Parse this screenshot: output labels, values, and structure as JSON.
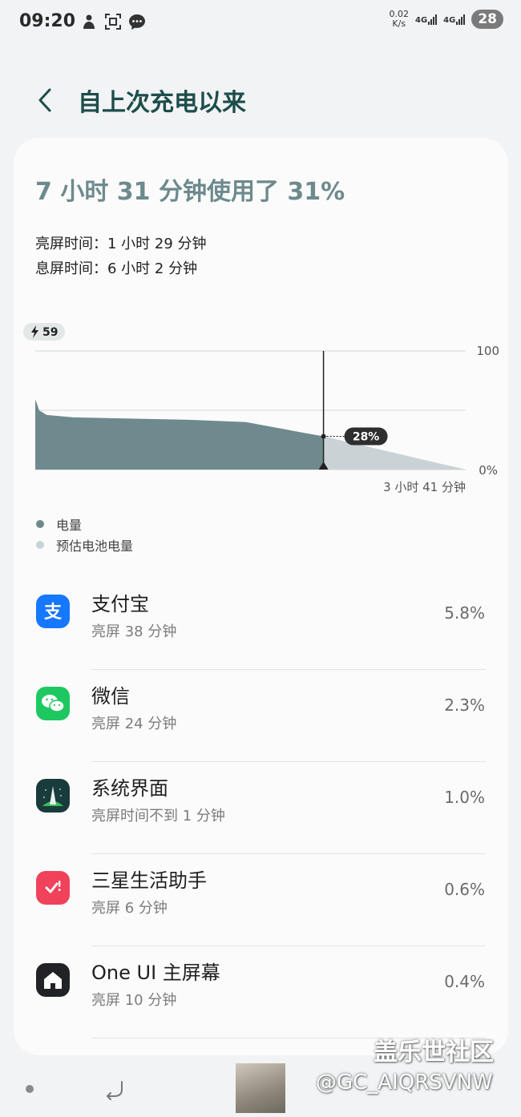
{
  "status_bar": {
    "time": "09:20",
    "speed_value": "0.02",
    "speed_unit": "K/s",
    "net1": "4G",
    "net2": "4G",
    "battery": "28",
    "icons": [
      "gesture-icon",
      "screenshot-icon",
      "message-icon"
    ]
  },
  "header": {
    "title": "自上次充电以来"
  },
  "summary": {
    "title": "7 小时 31 分钟使用了 31%",
    "screen_on": "亮屏时间：1 小时 29 分钟",
    "screen_off": "息屏时间：6 小时 2 分钟"
  },
  "chart_data": {
    "type": "area",
    "start_badge": "59",
    "y_max_label": "100",
    "y_min_label": "0%",
    "ylim": [
      0,
      100
    ],
    "current_label": "28%",
    "remaining_label": "3 小时 41 分钟",
    "series": [
      {
        "name": "电量",
        "color": "#6f8a8e",
        "points": [
          [
            0,
            59
          ],
          [
            0.05,
            55
          ],
          [
            0.1,
            50
          ],
          [
            0.2,
            48
          ],
          [
            0.3,
            46
          ],
          [
            1.0,
            44
          ],
          [
            4.0,
            42
          ],
          [
            5.5,
            40
          ],
          [
            6.5,
            34
          ],
          [
            7.0,
            31
          ],
          [
            7.52,
            28
          ]
        ]
      },
      {
        "name": "预估电池电量",
        "color": "#c9d3d5",
        "points": [
          [
            7.52,
            28
          ],
          [
            11.23,
            0
          ]
        ]
      }
    ],
    "x_range": [
      0,
      11.23
    ]
  },
  "legend": {
    "items": [
      {
        "label": "电量",
        "color": "#6f8a8e"
      },
      {
        "label": "预估电池电量",
        "color": "#c9d3d5"
      }
    ]
  },
  "apps": [
    {
      "name": "支付宝",
      "sub": "亮屏 38 分钟",
      "pct": "5.8%",
      "icon": "alipay-icon",
      "color": "#1677ff"
    },
    {
      "name": "微信",
      "sub": "亮屏 24 分钟",
      "pct": "2.3%",
      "icon": "wechat-icon",
      "color": "#1ec861"
    },
    {
      "name": "系统界面",
      "sub": "亮屏时间不到 1 分钟",
      "pct": "1.0%",
      "icon": "system-ui-icon",
      "color": "#1a3b3c"
    },
    {
      "name": "三星生活助手",
      "sub": "亮屏 6 分钟",
      "pct": "0.6%",
      "icon": "reminder-icon",
      "color": "#f0425b"
    },
    {
      "name": "One UI 主屏幕",
      "sub": "亮屏 10 分钟",
      "pct": "0.4%",
      "icon": "home-icon",
      "color": "#222326"
    }
  ],
  "watermark": {
    "title": "盖乐世社区",
    "handle": "@GC_AIQRSVNW"
  }
}
